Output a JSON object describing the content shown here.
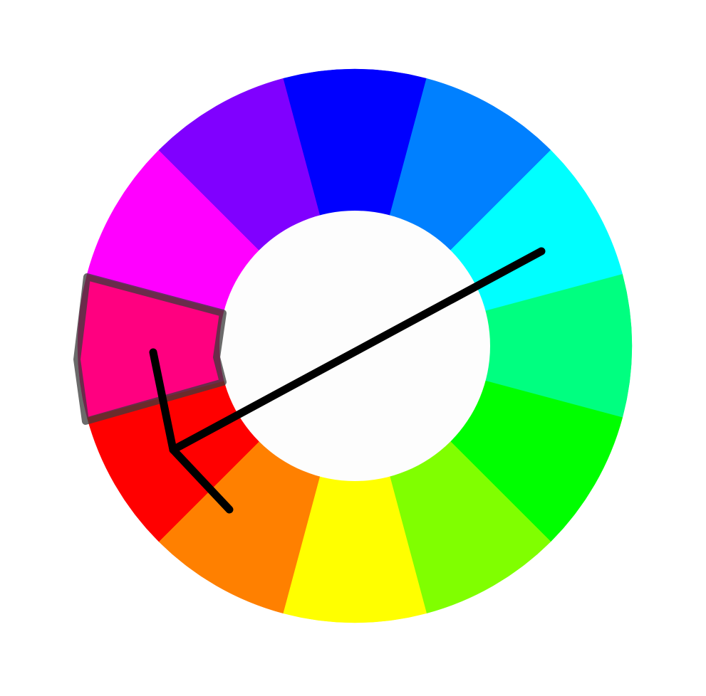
{
  "color_wheel": {
    "segments": [
      {
        "name": "blue",
        "color": "#0000ff"
      },
      {
        "name": "azure",
        "color": "#0080ff"
      },
      {
        "name": "cyan",
        "color": "#00ffff"
      },
      {
        "name": "spring-green",
        "color": "#00ff80"
      },
      {
        "name": "green",
        "color": "#00ff00"
      },
      {
        "name": "chartreuse",
        "color": "#80ff00"
      },
      {
        "name": "yellow",
        "color": "#ffff00"
      },
      {
        "name": "orange",
        "color": "#ff8000"
      },
      {
        "name": "red",
        "color": "#ff0000"
      },
      {
        "name": "rose",
        "color": "#ff0080"
      },
      {
        "name": "magenta",
        "color": "#ff00ff"
      },
      {
        "name": "violet",
        "color": "#8000ff"
      }
    ],
    "highlighted_segment": "rose",
    "highlight_outline_color": "#3a3a3a",
    "arrow_color": "#000000"
  }
}
